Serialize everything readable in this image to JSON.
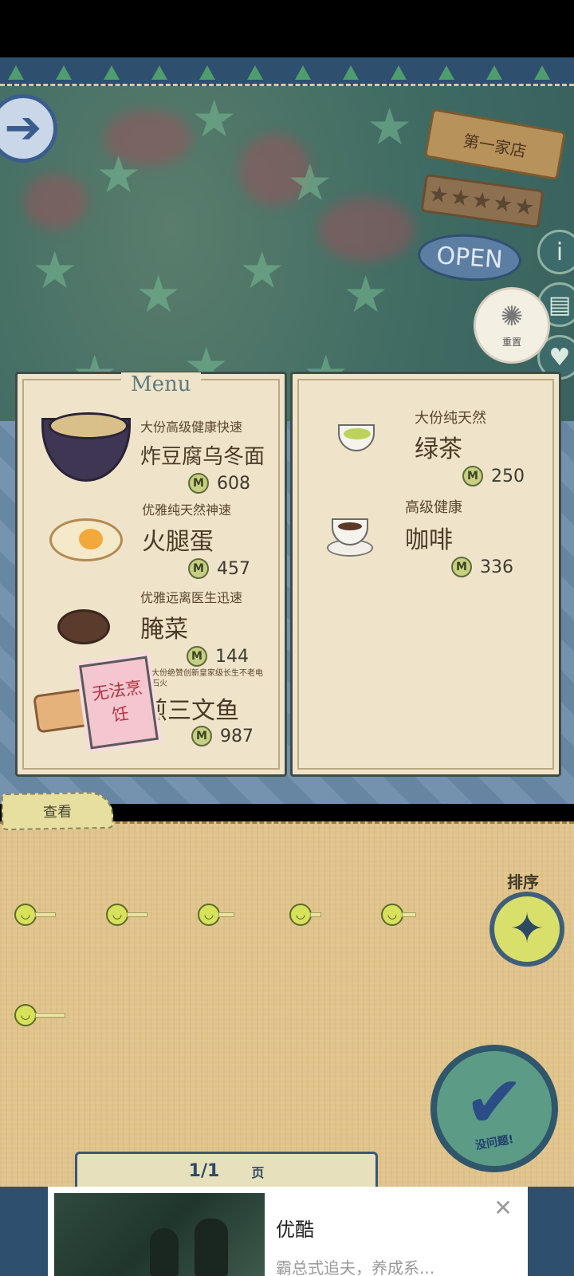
{
  "shop": {
    "name": "第一家店",
    "rating_stars": "★★★★★",
    "open_label": "OPEN"
  },
  "controls": {
    "reset_label": "重置",
    "view_tab": "查看",
    "sort_label": "排序",
    "confirm_label": "没问题!"
  },
  "menu": {
    "title": "Menu",
    "left": [
      {
        "sub": "大份高级健康快速",
        "name": "炸豆腐乌冬面",
        "price": "608",
        "icon": "udon-bowl"
      },
      {
        "sub": "优雅纯天然神速",
        "name": "火腿蛋",
        "price": "457",
        "icon": "ham-egg-plate"
      },
      {
        "sub": "优雅远离医生迅速",
        "name": "腌菜",
        "price": "144",
        "icon": "pickles-dish"
      },
      {
        "sub": "巨大份绝赞创新皇家级长生不老电光石火",
        "name": "煎三文鱼",
        "price": "987",
        "icon": "grilled-salmon",
        "status": "无法烹饪"
      }
    ],
    "right": [
      {
        "sub": "大份纯天然",
        "name": "绿茶",
        "price": "250",
        "icon": "green-tea-cup"
      },
      {
        "sub": "高级健康",
        "name": "咖啡",
        "price": "336",
        "icon": "coffee-cup"
      }
    ]
  },
  "currency_symbol": "M",
  "pager": {
    "page": "1/1",
    "unit": "页"
  },
  "ad": {
    "title": "优酷",
    "description": "霸总式追夫，养成系..."
  }
}
